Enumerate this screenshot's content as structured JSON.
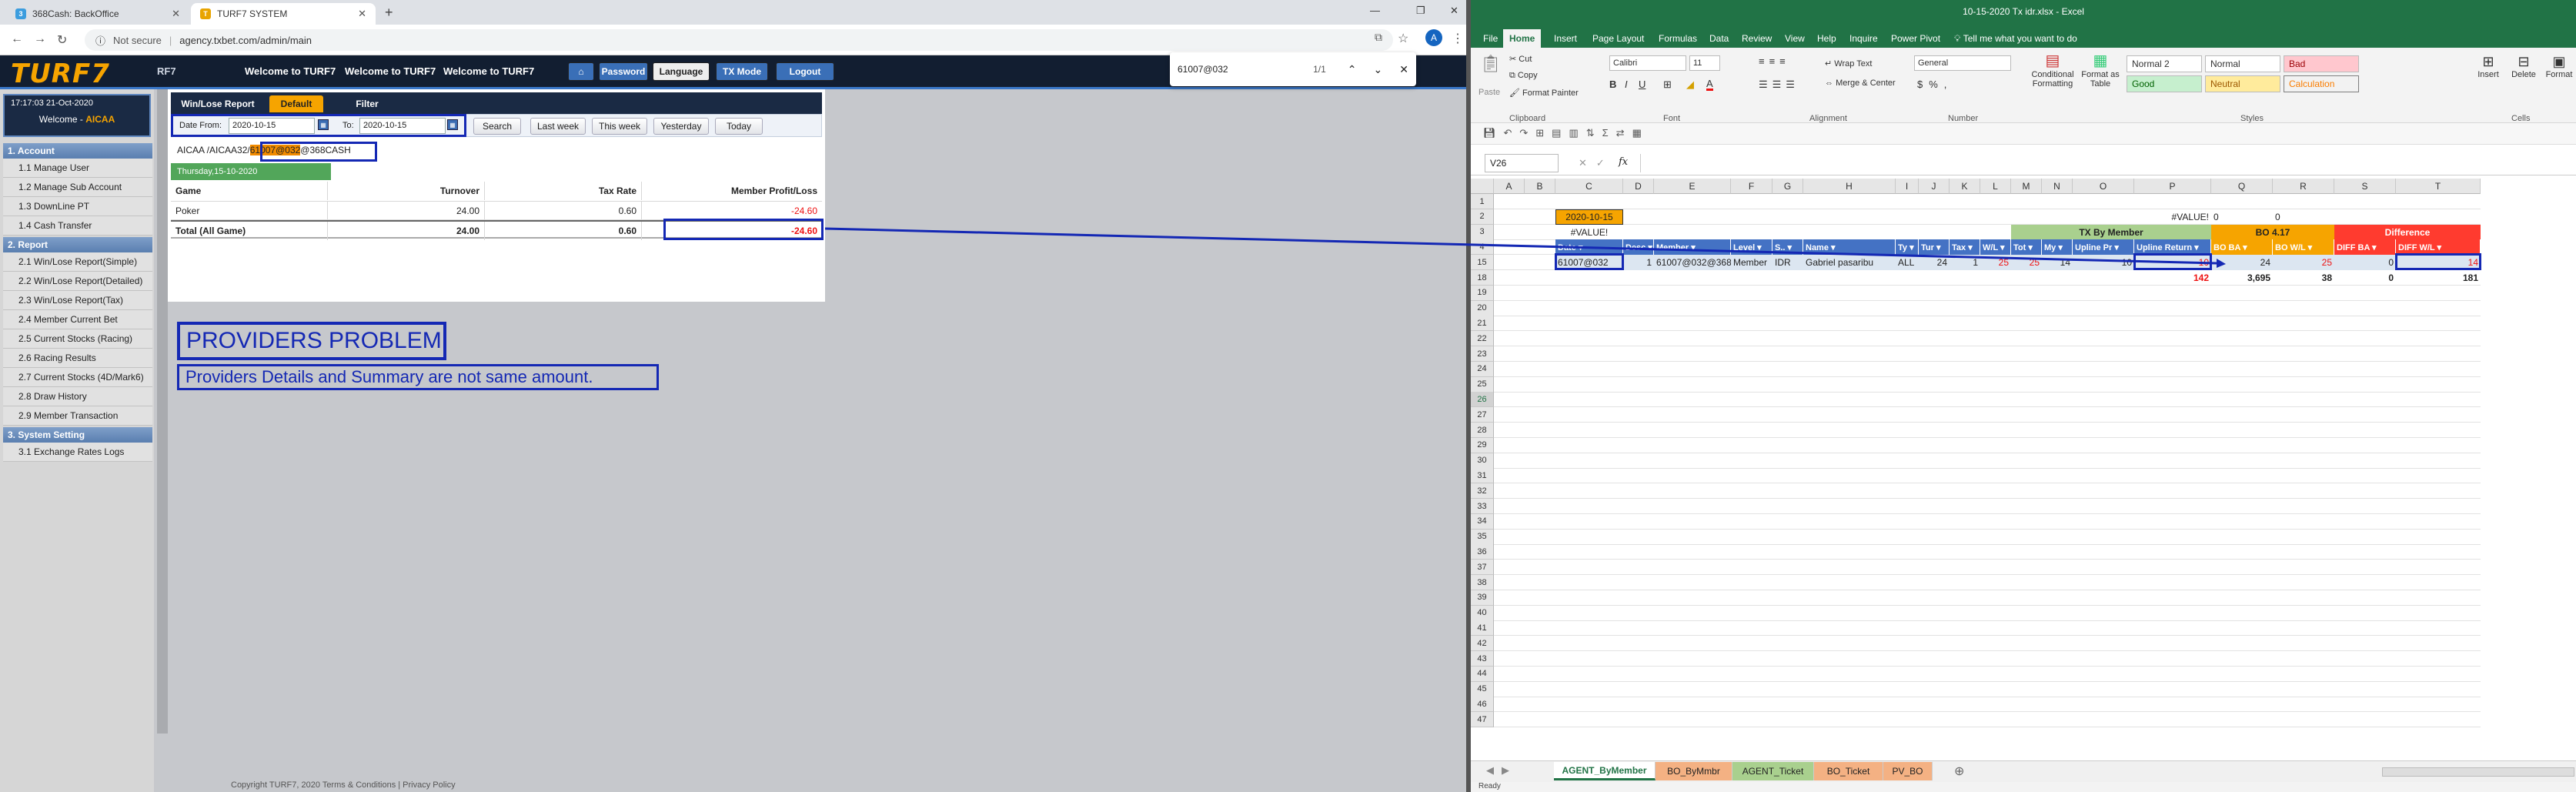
{
  "browser": {
    "tabs": [
      {
        "title": "368Cash: BackOffice",
        "icon_color": "#3c9dde"
      },
      {
        "title": "TURF7 SYSTEM",
        "icon_color": "#e8a400"
      }
    ],
    "url_security": "Not secure",
    "url": "agency.txbet.com/admin/main",
    "find": {
      "query": "61007@032",
      "count": "1/1"
    },
    "avatar": "A"
  },
  "site": {
    "logo": "TURF7",
    "marquee_prefix": "RF7",
    "welcome": [
      "Welcome to TURF7",
      "Welcome to TURF7",
      "Welcome to TURF7"
    ],
    "buttons": {
      "password": "Password",
      "language": "Language",
      "txmode": "TX Mode",
      "logout": "Logout"
    }
  },
  "sidebar": {
    "timestamp": "17:17:03 21-Oct-2020",
    "welcome_prefix": "Welcome - ",
    "username": "AICAA",
    "sections": [
      {
        "title": "1. Account",
        "items": [
          "1.1 Manage User",
          "1.2 Manage Sub Account",
          "1.3 DownLine PT",
          "1.4 Cash Transfer"
        ]
      },
      {
        "title": "2. Report",
        "items": [
          "2.1 Win/Lose Report(Simple)",
          "2.2 Win/Lose Report(Detailed)",
          "2.3 Win/Lose Report(Tax)",
          "2.4 Member Current Bet",
          "2.5 Current Stocks (Racing)",
          "2.6 Racing Results",
          "2.7 Current Stocks (4D/Mark6)",
          "2.8 Draw History",
          "2.9 Member Transaction"
        ]
      },
      {
        "title": "3. System Setting",
        "items": [
          "3.1 Exchange Rates Logs"
        ]
      }
    ]
  },
  "report": {
    "title": "Win/Lose Report",
    "tab_default": "Default",
    "tab_filter": "Filter",
    "date_from_label": "Date From:",
    "date_from": "2020-10-15",
    "date_to_label": "To:",
    "date_to": "2020-10-15",
    "buttons": [
      "Search",
      "Last week",
      "This week",
      "Yesterday",
      "Today"
    ],
    "crumb_prefix": "AICAA /AICAA32/",
    "crumb_highlight": "61007@032",
    "crumb_suffix": "@368CASH",
    "date_header": "Thursday,15-10-2020",
    "columns": [
      "Game",
      "Turnover",
      "Tax Rate",
      "Member Profit/Loss"
    ],
    "rows": [
      {
        "game": "Poker",
        "turnover": "24.00",
        "tax": "0.60",
        "pl": "-24.60"
      }
    ],
    "total": {
      "game": "Total (All Game)",
      "turnover": "24.00",
      "tax": "0.60",
      "pl": "-24.60"
    }
  },
  "annotations": {
    "title": "PROVIDERS PROBLEM",
    "subtitle": "Providers Details and Summary are not same amount."
  },
  "footer": "Copyright TURF7, 2020 Terms & Conditions | Privacy Policy",
  "excel": {
    "title": "10-15-2020 Tx idr.xlsx  -  Excel",
    "ribbon_tabs": [
      "File",
      "Home",
      "Insert",
      "Page Layout",
      "Formulas",
      "Data",
      "Review",
      "View",
      "Help",
      "Inquire",
      "Power Pivot"
    ],
    "tell_me": "Tell me what you want to do",
    "clipboard": {
      "paste": "Paste",
      "cut": "Cut",
      "copy": "Copy",
      "format_painter": "Format Painter",
      "label": "Clipboard"
    },
    "font": {
      "name": "Calibri",
      "size": "11",
      "label": "Font"
    },
    "alignment": {
      "wrap": "Wrap Text",
      "merge": "Merge & Center",
      "label": "Alignment"
    },
    "number": {
      "format": "General",
      "label": "Number"
    },
    "styles": {
      "conditional": "Conditional Formatting",
      "format_as_table": "Format as Table",
      "normal2": "Normal 2",
      "normal": "Normal",
      "bad": "Bad",
      "good": "Good",
      "neutral": "Neutral",
      "calculation": "Calculation",
      "label": "Styles"
    },
    "cells": {
      "insert": "Insert",
      "delete": "Delete",
      "format": "Format",
      "label": "Cells"
    },
    "namebox": "V26",
    "columns": [
      "A",
      "B",
      "C",
      "D",
      "E",
      "F",
      "G",
      "H",
      "I",
      "J",
      "K",
      "L",
      "M",
      "N",
      "O",
      "P",
      "Q",
      "R",
      "S",
      "T"
    ],
    "row_numbers": [
      "1",
      "2",
      "3",
      "4",
      "15",
      "18",
      "19",
      "20",
      "21",
      "22",
      "23",
      "24",
      "25",
      "26",
      "27",
      "28",
      "29",
      "30",
      "31",
      "32",
      "33",
      "34",
      "35",
      "36",
      "37",
      "38",
      "39",
      "40",
      "41",
      "42",
      "43",
      "44",
      "45",
      "46",
      "47"
    ],
    "cells_data": {
      "c2": "2020-10-15",
      "c3": "#VALUE!",
      "p2": "#VALUE!",
      "q2": "0",
      "r2": "0",
      "tx_by_member": "TX By Member",
      "bo_title": "BO 4.17",
      "difference": "Difference",
      "header_row": [
        "Date",
        "Desc",
        "Member",
        "Level",
        "S..",
        "Name",
        "Ty",
        "Tur",
        "Tax",
        "W/L",
        "Tot",
        "My",
        "Upline Pr",
        "Upline Return",
        "BO BA",
        "BO W/L",
        "DIFF BA",
        "DIFF W/L"
      ],
      "row15": {
        "c": "61007@032",
        "d": "1",
        "e": "61007@032@368CASH",
        "f": "Member",
        "g": "IDR",
        "h": "Gabriel pasaribu",
        "i": "ALL",
        "j": "24",
        "k": "1",
        "l": "25",
        "m": "25",
        "n": "14",
        "o": "10",
        "p": "10",
        "q": "24",
        "r": "25",
        "s": "0",
        "t": "14"
      },
      "row18": {
        "p": "142",
        "q": "3,695",
        "r": "38",
        "s": "0",
        "t": "181"
      }
    },
    "sheets": [
      "AGENT_ByMember",
      "BO_ByMmbr",
      "AGENT_Ticket",
      "BO_Ticket",
      "PV_BO"
    ],
    "status": "Ready"
  },
  "colors": {
    "accent_orange": "#f6a400",
    "annotation_blue": "#1428b4",
    "excel_green": "#217346",
    "negative_red": "#ee1111"
  }
}
